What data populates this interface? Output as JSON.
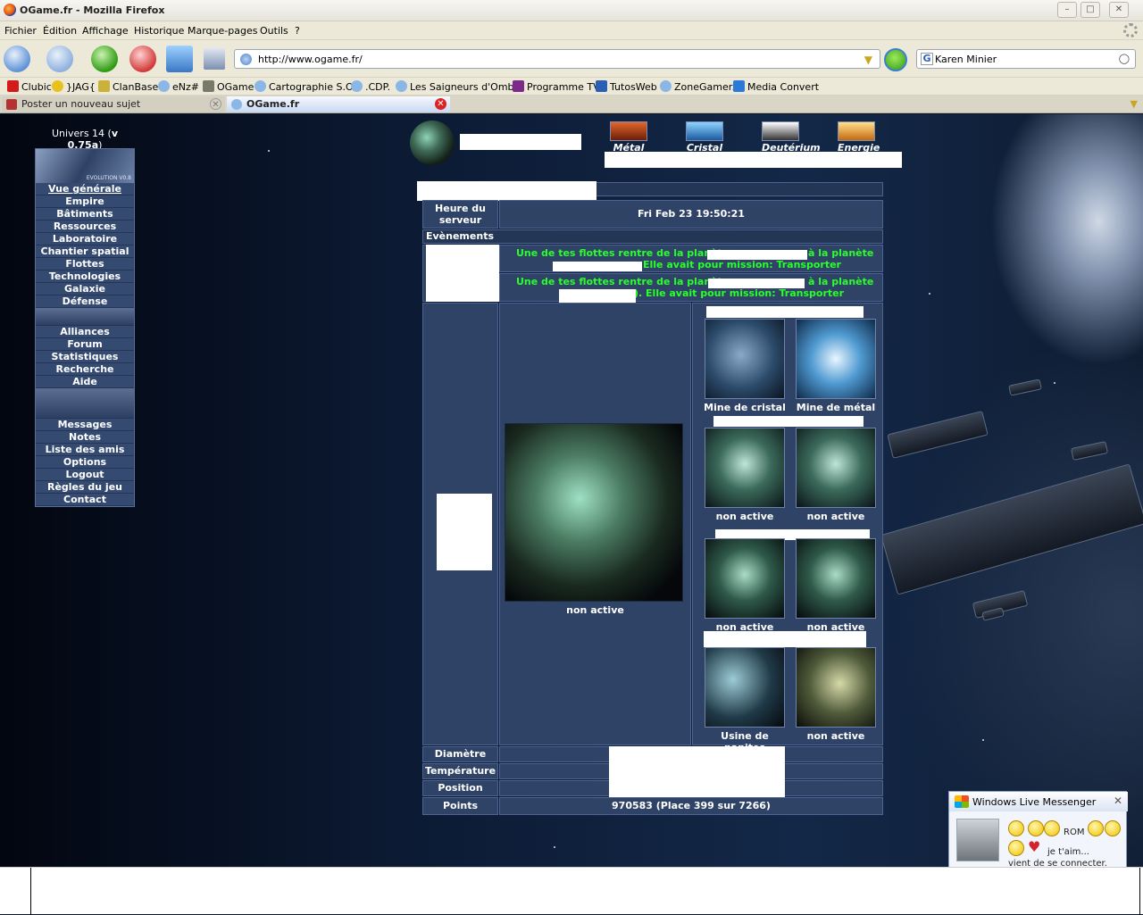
{
  "window": {
    "title": "OGame.fr - Mozilla Firefox"
  },
  "menubar": [
    "Fichier",
    "Édition",
    "Affichage",
    "Historique",
    "Marque-pages",
    "Outils",
    "?"
  ],
  "navbar": {
    "url": "http://www.ogame.fr/",
    "search_value": "Karen Minier"
  },
  "bookmarks": [
    "Clubic",
    "}JAG{",
    "ClanBase",
    "eNz#",
    "OGame",
    "Cartographie S.O",
    ".CDP.",
    "Les Saigneurs d'Ombre",
    "Programme TV",
    "TutosWeb",
    "ZoneGamerz",
    "Media Convert"
  ],
  "tabs": [
    {
      "label": "Poster un nouveau sujet"
    },
    {
      "label": "OGame.fr"
    }
  ],
  "left_menu": {
    "universe_prefix": "Univers 14 (",
    "version": "v 0.75a",
    "universe_suffix": ")",
    "logo_text": "EVOLUTION V0.8",
    "group1": [
      "Vue générale",
      "Empire",
      "Bâtiments",
      "Ressources",
      "Laboratoire",
      "Chantier spatial",
      "Flottes",
      "Technologies",
      "Galaxie",
      "Défense"
    ],
    "group2": [
      "Alliances",
      "Forum",
      "Statistiques",
      "Recherche",
      "Aide"
    ],
    "group3": [
      "Messages",
      "Notes",
      "Liste des amis",
      "Options",
      "Logout",
      "Règles du jeu",
      "Contact"
    ]
  },
  "resources": [
    "Métal",
    "Cristal",
    "Deutérium",
    "Energie"
  ],
  "overview": {
    "server_time_label": "Heure du serveur",
    "server_time": "Fri Feb 23 19:50:21",
    "events_label": "Evènements",
    "event1_a": "Une de tes flottes rentre de la planète",
    "event1_b": "à la planète",
    "event1_c": " Elle avait pour mission: Transporter",
    "event2_a": "Une de tes flottes rentre de la planète",
    "event2_b": "à la planète",
    "event2_c": "). Elle avait pour mission: Transporter",
    "main_planet_status": "non active",
    "slots": [
      "Mine de cristal",
      "Mine de métal",
      "non active",
      "non active",
      "non active",
      "non active",
      "Usine de nanites",
      "non active"
    ],
    "diameter_label": "Diamètre",
    "temperature_label": "Température",
    "position_label": "Position",
    "points_label": "Points",
    "points_value": "970583 (Place 399 sur 7266)"
  },
  "messenger": {
    "title": "Windows Live Messenger",
    "line1": "ROM",
    "line2": "je t'aim...",
    "line3": "vient de se connecter."
  },
  "colors": {
    "event_text": "#2bff2b",
    "panel": "#2f4367",
    "border": "#4e6392"
  }
}
